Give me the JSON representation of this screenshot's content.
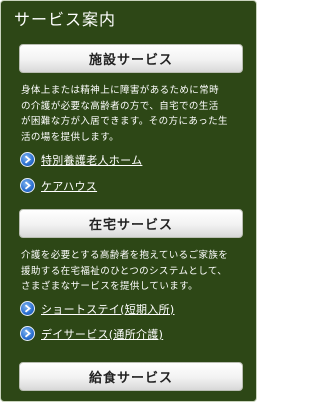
{
  "panel": {
    "title": "サービス案内"
  },
  "sections": [
    {
      "button_label": "施設サービス",
      "description_lines": [
        "身体上または精神上に障害があるために常時",
        "の介護が必要な高齢者の方で、自宅での生活",
        "が困難な方が入居できます。その方にあった生",
        "活の場を提供します。"
      ],
      "links": [
        {
          "label": "特別養護老人ホーム",
          "icon": "arrow-right-circle-icon"
        },
        {
          "label": "ケアハウス",
          "icon": "arrow-right-circle-icon"
        }
      ]
    },
    {
      "button_label": "在宅サービス",
      "description_lines": [
        "介護を必要とする高齢者を抱えているご家族を",
        "援助する在宅福祉のひとつのシステムとして、",
        "さまざまなサービスを提供しています。"
      ],
      "links": [
        {
          "label": "ショートステイ(短期入所)",
          "icon": "arrow-right-circle-icon"
        },
        {
          "label": "デイサービス(通所介護)",
          "icon": "arrow-right-circle-icon"
        }
      ]
    },
    {
      "button_label": "給食サービス"
    }
  ],
  "colors": {
    "panel_background": "#2d4716",
    "text": "#ffffff",
    "link_icon": "#2a6fd0"
  }
}
